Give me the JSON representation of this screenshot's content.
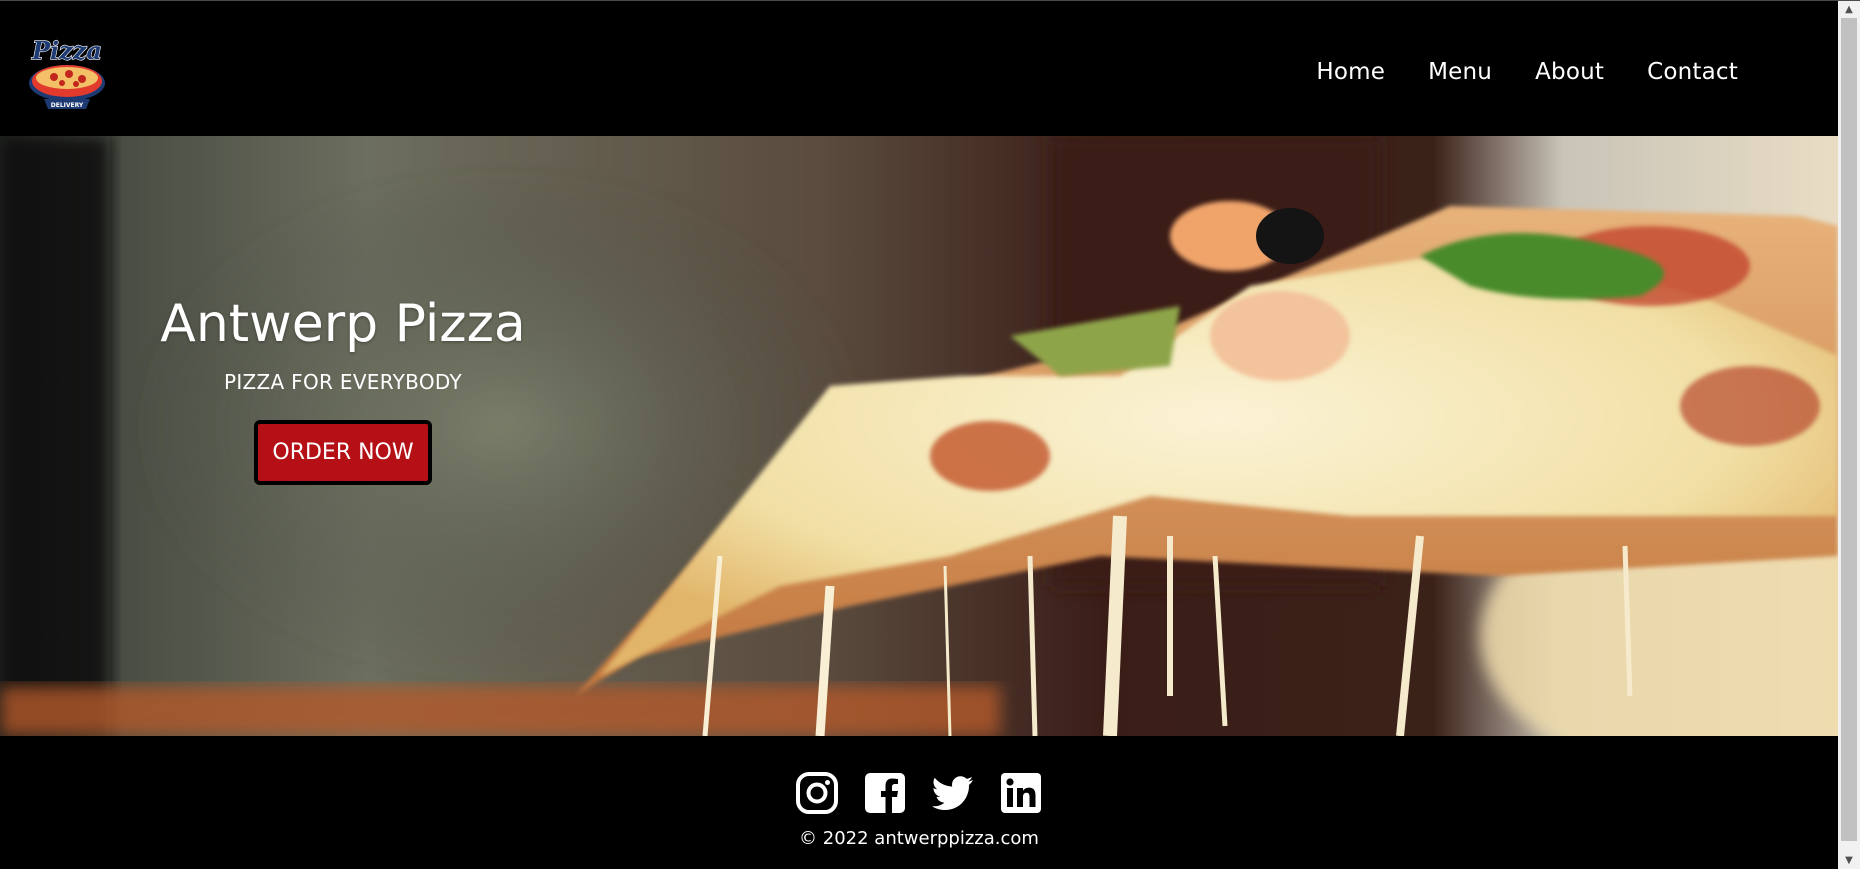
{
  "nav": {
    "items": [
      {
        "label": "Home"
      },
      {
        "label": "Menu"
      },
      {
        "label": "About"
      },
      {
        "label": "Contact"
      }
    ]
  },
  "logo": {
    "text": "Pizza",
    "subtext": "DELIVERY"
  },
  "hero": {
    "title": "Antwerp Pizza",
    "subtitle": "PIZZA FOR EVERYBODY",
    "cta_label": "ORDER NOW"
  },
  "footer": {
    "socials": [
      {
        "icon": "instagram-icon"
      },
      {
        "icon": "facebook-icon"
      },
      {
        "icon": "twitter-icon"
      },
      {
        "icon": "linkedin-icon"
      }
    ],
    "copyright": "© 2022 antwerppizza.com"
  },
  "colors": {
    "background": "#000000",
    "accent": "#b51016",
    "text": "#ffffff"
  }
}
